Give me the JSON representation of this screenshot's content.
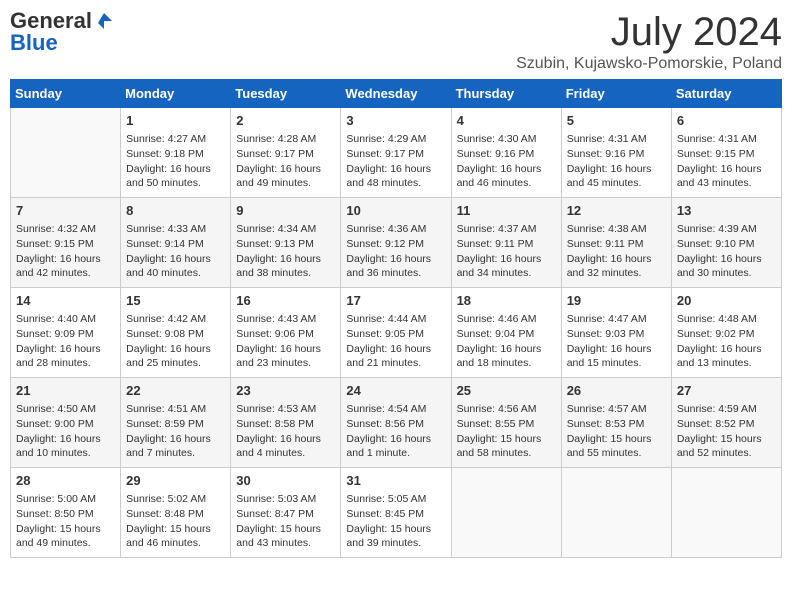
{
  "header": {
    "logo_general": "General",
    "logo_blue": "Blue",
    "month_year": "July 2024",
    "location": "Szubin, Kujawsko-Pomorskie, Poland"
  },
  "days_of_week": [
    "Sunday",
    "Monday",
    "Tuesday",
    "Wednesday",
    "Thursday",
    "Friday",
    "Saturday"
  ],
  "weeks": [
    [
      {
        "day": "",
        "info": ""
      },
      {
        "day": "1",
        "info": "Sunrise: 4:27 AM\nSunset: 9:18 PM\nDaylight: 16 hours and 50 minutes."
      },
      {
        "day": "2",
        "info": "Sunrise: 4:28 AM\nSunset: 9:17 PM\nDaylight: 16 hours and 49 minutes."
      },
      {
        "day": "3",
        "info": "Sunrise: 4:29 AM\nSunset: 9:17 PM\nDaylight: 16 hours and 48 minutes."
      },
      {
        "day": "4",
        "info": "Sunrise: 4:30 AM\nSunset: 9:16 PM\nDaylight: 16 hours and 46 minutes."
      },
      {
        "day": "5",
        "info": "Sunrise: 4:31 AM\nSunset: 9:16 PM\nDaylight: 16 hours and 45 minutes."
      },
      {
        "day": "6",
        "info": "Sunrise: 4:31 AM\nSunset: 9:15 PM\nDaylight: 16 hours and 43 minutes."
      }
    ],
    [
      {
        "day": "7",
        "info": "Sunrise: 4:32 AM\nSunset: 9:15 PM\nDaylight: 16 hours and 42 minutes."
      },
      {
        "day": "8",
        "info": "Sunrise: 4:33 AM\nSunset: 9:14 PM\nDaylight: 16 hours and 40 minutes."
      },
      {
        "day": "9",
        "info": "Sunrise: 4:34 AM\nSunset: 9:13 PM\nDaylight: 16 hours and 38 minutes."
      },
      {
        "day": "10",
        "info": "Sunrise: 4:36 AM\nSunset: 9:12 PM\nDaylight: 16 hours and 36 minutes."
      },
      {
        "day": "11",
        "info": "Sunrise: 4:37 AM\nSunset: 9:11 PM\nDaylight: 16 hours and 34 minutes."
      },
      {
        "day": "12",
        "info": "Sunrise: 4:38 AM\nSunset: 9:11 PM\nDaylight: 16 hours and 32 minutes."
      },
      {
        "day": "13",
        "info": "Sunrise: 4:39 AM\nSunset: 9:10 PM\nDaylight: 16 hours and 30 minutes."
      }
    ],
    [
      {
        "day": "14",
        "info": "Sunrise: 4:40 AM\nSunset: 9:09 PM\nDaylight: 16 hours and 28 minutes."
      },
      {
        "day": "15",
        "info": "Sunrise: 4:42 AM\nSunset: 9:08 PM\nDaylight: 16 hours and 25 minutes."
      },
      {
        "day": "16",
        "info": "Sunrise: 4:43 AM\nSunset: 9:06 PM\nDaylight: 16 hours and 23 minutes."
      },
      {
        "day": "17",
        "info": "Sunrise: 4:44 AM\nSunset: 9:05 PM\nDaylight: 16 hours and 21 minutes."
      },
      {
        "day": "18",
        "info": "Sunrise: 4:46 AM\nSunset: 9:04 PM\nDaylight: 16 hours and 18 minutes."
      },
      {
        "day": "19",
        "info": "Sunrise: 4:47 AM\nSunset: 9:03 PM\nDaylight: 16 hours and 15 minutes."
      },
      {
        "day": "20",
        "info": "Sunrise: 4:48 AM\nSunset: 9:02 PM\nDaylight: 16 hours and 13 minutes."
      }
    ],
    [
      {
        "day": "21",
        "info": "Sunrise: 4:50 AM\nSunset: 9:00 PM\nDaylight: 16 hours and 10 minutes."
      },
      {
        "day": "22",
        "info": "Sunrise: 4:51 AM\nSunset: 8:59 PM\nDaylight: 16 hours and 7 minutes."
      },
      {
        "day": "23",
        "info": "Sunrise: 4:53 AM\nSunset: 8:58 PM\nDaylight: 16 hours and 4 minutes."
      },
      {
        "day": "24",
        "info": "Sunrise: 4:54 AM\nSunset: 8:56 PM\nDaylight: 16 hours and 1 minute."
      },
      {
        "day": "25",
        "info": "Sunrise: 4:56 AM\nSunset: 8:55 PM\nDaylight: 15 hours and 58 minutes."
      },
      {
        "day": "26",
        "info": "Sunrise: 4:57 AM\nSunset: 8:53 PM\nDaylight: 15 hours and 55 minutes."
      },
      {
        "day": "27",
        "info": "Sunrise: 4:59 AM\nSunset: 8:52 PM\nDaylight: 15 hours and 52 minutes."
      }
    ],
    [
      {
        "day": "28",
        "info": "Sunrise: 5:00 AM\nSunset: 8:50 PM\nDaylight: 15 hours and 49 minutes."
      },
      {
        "day": "29",
        "info": "Sunrise: 5:02 AM\nSunset: 8:48 PM\nDaylight: 15 hours and 46 minutes."
      },
      {
        "day": "30",
        "info": "Sunrise: 5:03 AM\nSunset: 8:47 PM\nDaylight: 15 hours and 43 minutes."
      },
      {
        "day": "31",
        "info": "Sunrise: 5:05 AM\nSunset: 8:45 PM\nDaylight: 15 hours and 39 minutes."
      },
      {
        "day": "",
        "info": ""
      },
      {
        "day": "",
        "info": ""
      },
      {
        "day": "",
        "info": ""
      }
    ]
  ]
}
